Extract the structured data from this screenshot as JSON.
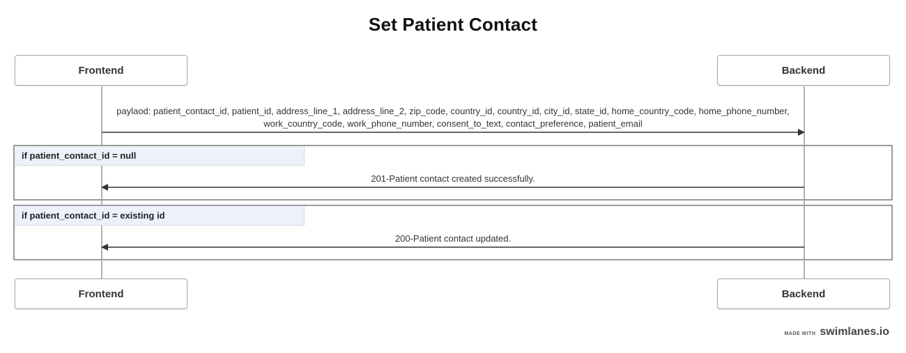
{
  "diagram": {
    "title": "Set Patient Contact",
    "participants": [
      {
        "name": "Frontend"
      },
      {
        "name": "Backend"
      }
    ],
    "messages": [
      {
        "from": "Frontend",
        "to": "Backend",
        "label_line1": "paylaod: patient_contact_id, patient_id, address_line_1, address_line_2, zip_code, country_id, country_id, city_id, state_id, home_country_code, home_phone_number,",
        "label_line2": "work_country_code, work_phone_number, consent_to_text, contact_preference, patient_email"
      }
    ],
    "blocks": [
      {
        "condition": "if patient_contact_id = null",
        "message": {
          "from": "Backend",
          "to": "Frontend",
          "label": "201-Patient contact created successfully."
        }
      },
      {
        "condition": "if patient_contact_id = existing id",
        "message": {
          "from": "Backend",
          "to": "Frontend",
          "label": "200-Patient contact updated."
        }
      }
    ]
  },
  "footer": {
    "made_with": "MADE WITH",
    "brand": "swimlanes.io"
  },
  "colors": {
    "line": "#333333",
    "lifeline": "#b0b0b0",
    "block_border": "#9a9a9a",
    "block_label_bg": "#eef1fa"
  }
}
